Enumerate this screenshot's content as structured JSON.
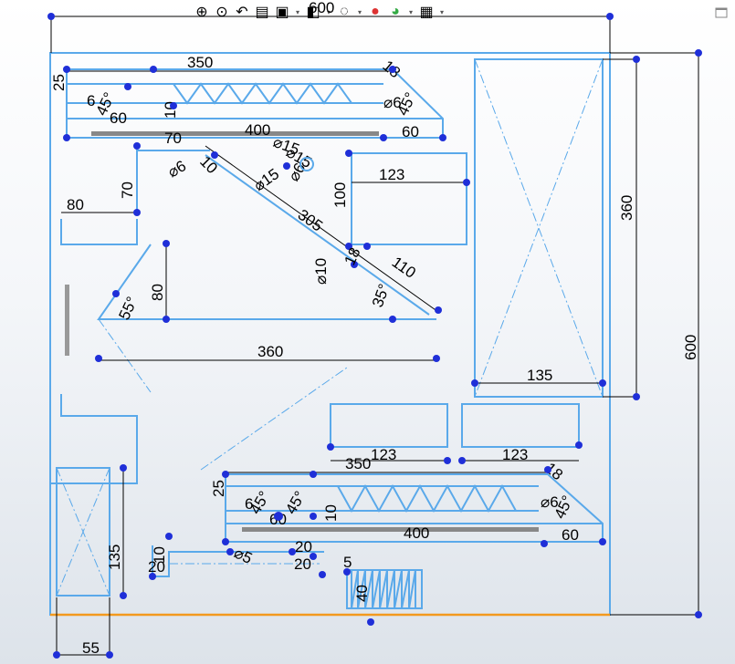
{
  "toolbar": {
    "icons": [
      "zoom-to-fit-icon",
      "zoom-area-icon",
      "previous-view-icon",
      "section-view-icon",
      "view-orientation-icon",
      "display-style-icon",
      "hide-show-icon",
      "edit-appearance-icon",
      "apply-scene-icon",
      "view-settings-icon"
    ],
    "icon_glyphs": [
      "⊕",
      "⊙",
      "↶",
      "▤",
      "▣",
      "◧",
      "◌",
      "●",
      "◕",
      "▦"
    ]
  },
  "dimensions": {
    "overall_width": "600",
    "overall_height": "600",
    "top_truss_length": "350",
    "top_truss_height": "25",
    "top_base_length": "400",
    "top_right_60": "60",
    "top_right_45": "45°",
    "top_left_45": "45°",
    "top_left_6": "6",
    "top_left_60": "60",
    "top_left_10": "10",
    "top_right_dia": "⌀15",
    "top_right_dia2": "⌀6",
    "top_right_18": "18",
    "left_70_h": "70",
    "left_70_v": "70",
    "dia_6_a": "⌀6",
    "dim_10_a": "10",
    "dia_15": "⌀15",
    "dia_15_b": "⌀15",
    "dia_6_b": "⌀6",
    "diag_305": "305",
    "box_123_a": "123",
    "box_100": "100",
    "left_80": "80",
    "left_80_v": "80",
    "ang_55": "55°",
    "dia_10": "⌀10",
    "dim_18": "18",
    "diag_110": "110",
    "ang_35": "35°",
    "base_360": "360",
    "right_360": "360",
    "right_135": "135",
    "box_123_b": "123",
    "box_123_c": "123",
    "bot_350": "350",
    "bot_25": "25",
    "bot_45_a": "45°",
    "bot_45_b": "45°",
    "bot_6": "6",
    "bot_60_a": "60",
    "bot_10": "10",
    "bot_400": "400",
    "bot_right_45": "45°",
    "bot_right_60": "60",
    "bot_right_dia": "⌀6",
    "bot_right_18": "18",
    "small_10": "10",
    "small_20_a": "20",
    "dia_5": "⌀5",
    "small_20_b": "20",
    "small_20_c": "20",
    "small_5": "5",
    "small_40": "40",
    "left_135": "135",
    "bottom_55": "55"
  }
}
